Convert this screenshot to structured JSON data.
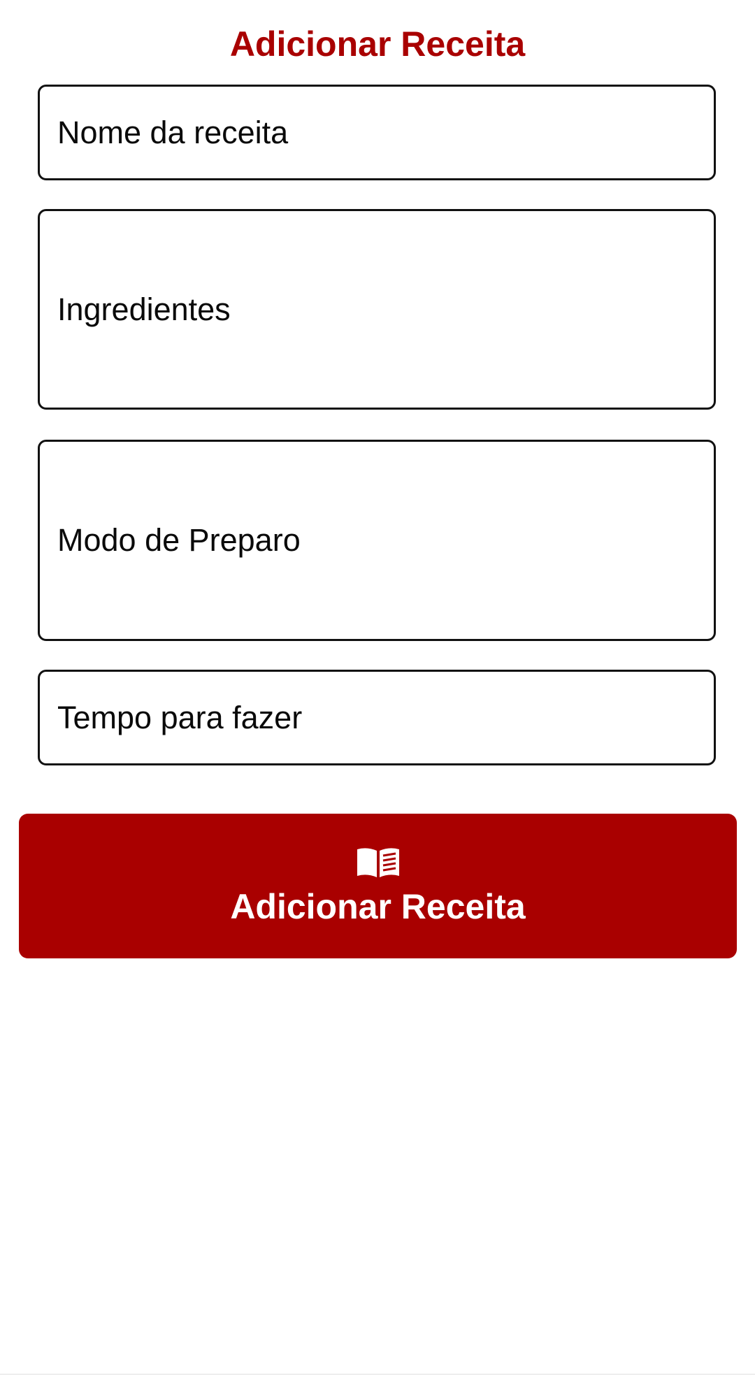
{
  "header": {
    "title": "Adicionar Receita"
  },
  "form": {
    "fields": {
      "nome": {
        "placeholder": "Nome da receita",
        "value": ""
      },
      "ingredientes": {
        "placeholder": "Ingredientes",
        "value": ""
      },
      "preparo": {
        "placeholder": "Modo de Preparo",
        "value": ""
      },
      "tempo": {
        "placeholder": "Tempo para fazer",
        "value": ""
      }
    },
    "submit": {
      "label": "Adicionar Receita",
      "icon": "open-book-icon"
    }
  },
  "colors": {
    "accent": "#a90000",
    "background": "#ffffff",
    "field_border": "#111111",
    "text": "#0a0a0a"
  }
}
